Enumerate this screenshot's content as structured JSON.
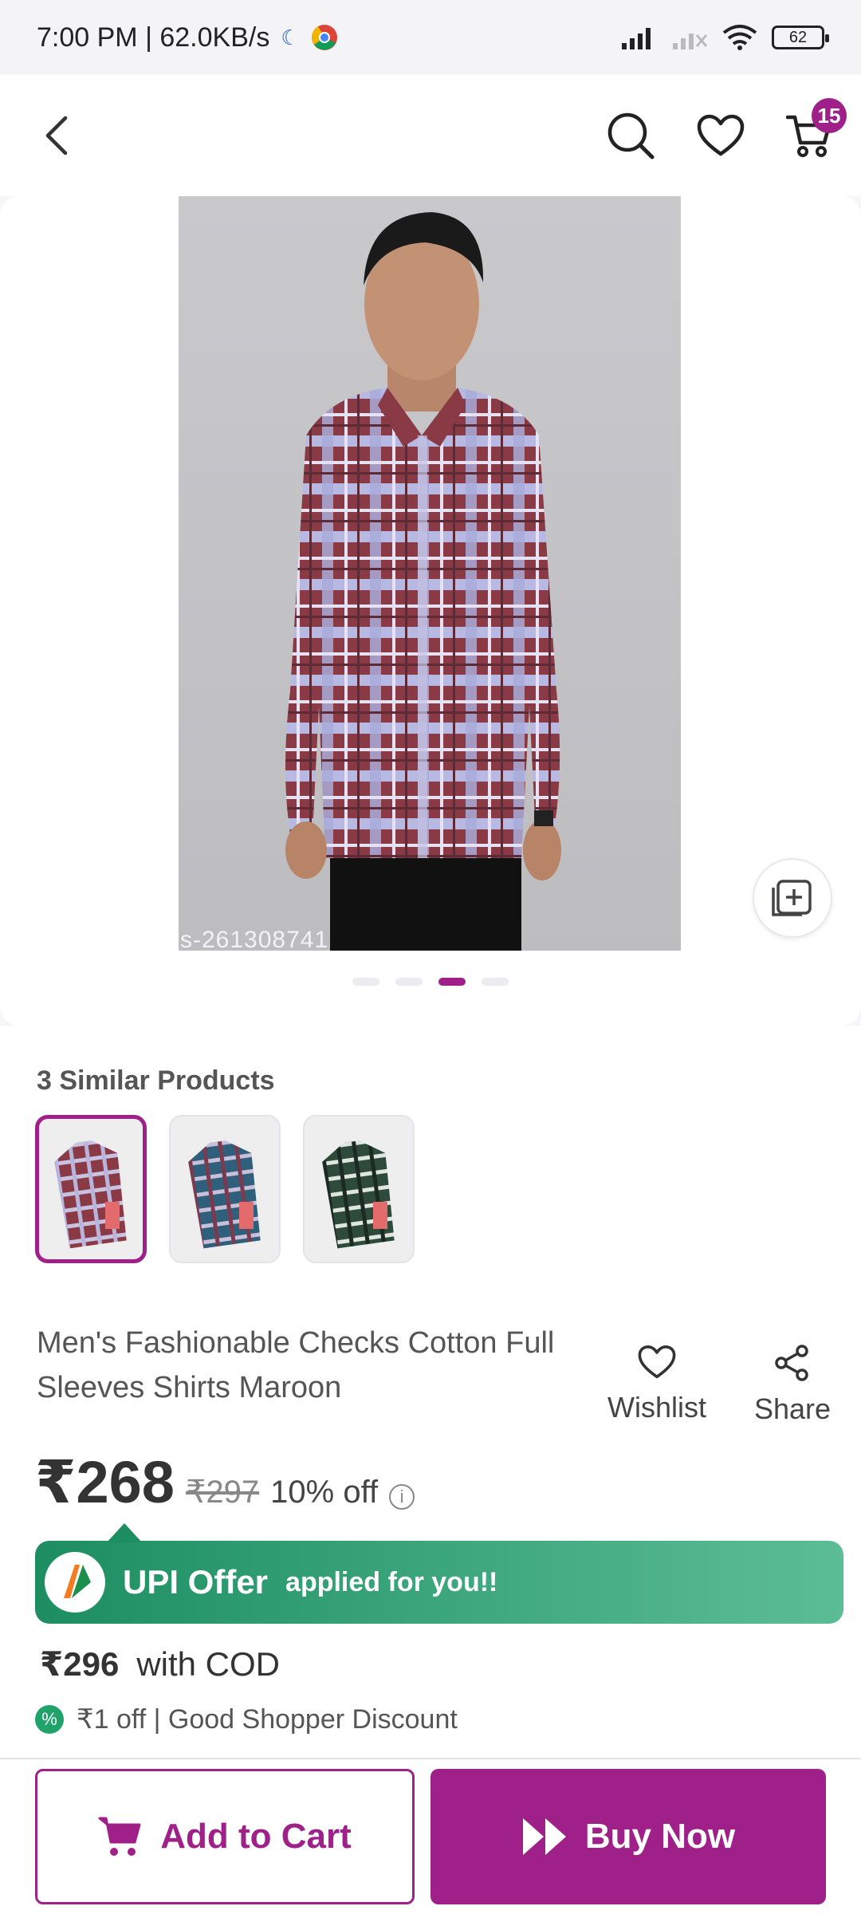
{
  "status_bar": {
    "time_speed": "7:00 PM | 62.0KB/s",
    "battery": "62"
  },
  "header": {
    "back_icon": "chevron-left-icon",
    "search_icon": "search-icon",
    "wishlist_icon": "heart-icon",
    "cart_icon": "cart-icon",
    "cart_count": "15"
  },
  "product_image": {
    "code": "s-261308741",
    "carousel_pages": 4,
    "active_page": 3
  },
  "similar": {
    "title": "3 Similar Products",
    "thumbnails": [
      {
        "color": "#8a3a45",
        "selected": true
      },
      {
        "color": "#2f5f7a",
        "selected": false
      },
      {
        "color": "#2e4a3a",
        "selected": false
      }
    ]
  },
  "product": {
    "title": "Men's Fashionable Checks Cotton Full Sleeves Shirts Maroon",
    "wishlist_label": "Wishlist",
    "share_label": "Share",
    "price": "₹268",
    "old_price": "₹297",
    "discount": "10% off"
  },
  "upi_offer": {
    "title": "UPI Offer",
    "subtitle": "applied for you!!"
  },
  "cod": {
    "price": "₹296",
    "label": "with COD"
  },
  "shopper_discount": {
    "text": "₹1 off | Good Shopper Discount"
  },
  "actions": {
    "add_to_cart": "Add to Cart",
    "buy_now": "Buy Now"
  },
  "colors": {
    "brand": "#9f2089",
    "upi_green": "#1d8e62"
  }
}
